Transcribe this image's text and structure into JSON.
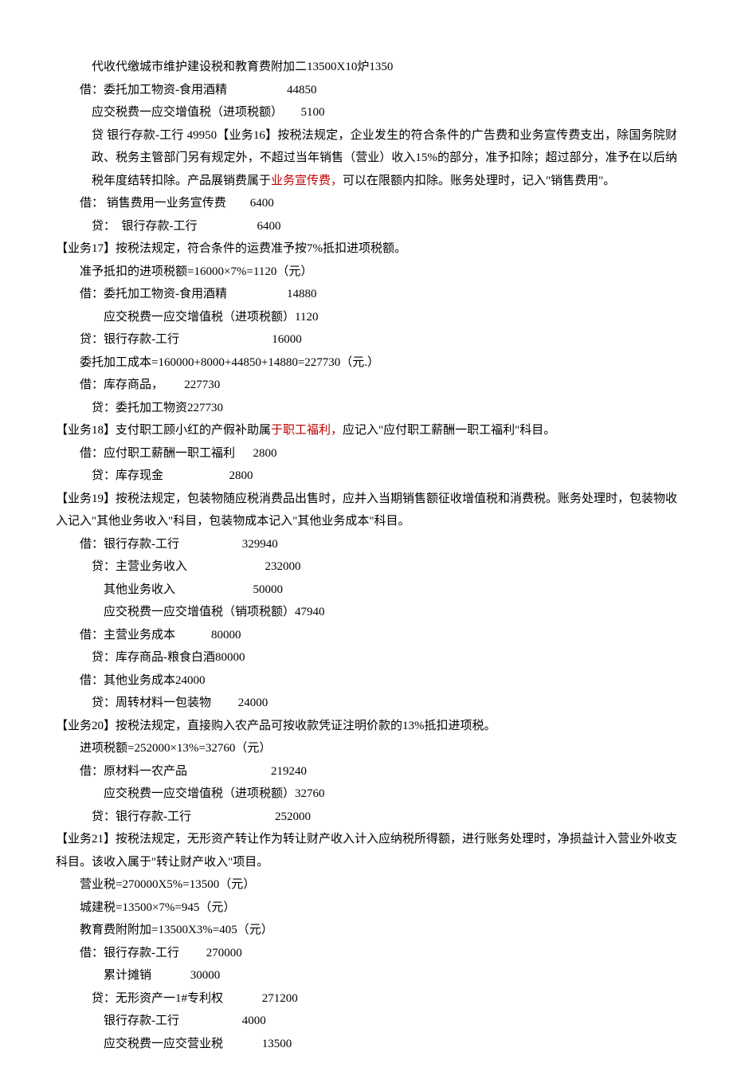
{
  "lines": [
    {
      "cls": "indent2",
      "parts": [
        {
          "t": "代收代缴城市维护建设税和教育费附加二13500X10炉1350"
        }
      ]
    },
    {
      "cls": "indent1",
      "parts": [
        {
          "t": "借：委托加工物资-食用酒精                    44850"
        }
      ]
    },
    {
      "cls": "indent2",
      "parts": [
        {
          "t": "应交税费一应交增值税（进项税额）      5100"
        }
      ]
    },
    {
      "cls": "indent2 para",
      "parts": [
        {
          "t": "贷 银行存款-工行                      49950【业务16】按税法规定，企业发生的符合条件的广告费和业务宣传费支出，除国务院财政、税务主管部门另有规定外，不超过当年销售（营业）收入15%的部分，准予扣除；超过部分，准予在以后纳税年度结转扣除。产品展销费属于"
        },
        {
          "t": "业务宣传费，",
          "red": true
        },
        {
          "t": "可以在限额内扣除。账务处理时，记入\"销售费用\"。"
        }
      ],
      "wrap": true
    },
    {
      "cls": "indent1",
      "parts": [
        {
          "t": "借： 销售费用一业务宣传费        6400"
        }
      ]
    },
    {
      "cls": "indent2",
      "parts": [
        {
          "t": "贷：  银行存款-工行                    6400"
        }
      ]
    },
    {
      "cls": "",
      "parts": [
        {
          "t": "【业务17】按税法规定，符合条件的运费准予按7%抵扣进项税额。"
        }
      ]
    },
    {
      "cls": "indent1",
      "parts": [
        {
          "t": "准予抵扣的进项税额=16000×7%=1120（元）"
        }
      ]
    },
    {
      "cls": "indent1",
      "parts": [
        {
          "t": "借：委托加工物资-食用酒精                    14880"
        }
      ]
    },
    {
      "cls": "indent3",
      "parts": [
        {
          "t": "应交税费一应交增值税（进项税额）1120"
        }
      ]
    },
    {
      "cls": "indent1",
      "parts": [
        {
          "t": "贷：银行存款-工行                               16000"
        }
      ]
    },
    {
      "cls": "indent1",
      "parts": [
        {
          "t": "委托加工成本=160000+8000+44850+14880=227730（元.）"
        }
      ]
    },
    {
      "cls": "indent1",
      "parts": [
        {
          "t": "借：库存商品，       227730"
        }
      ]
    },
    {
      "cls": "indent2",
      "parts": [
        {
          "t": "贷：委托加工物资227730"
        }
      ]
    },
    {
      "cls": "",
      "parts": [
        {
          "t": "【业务18】支付职工顾小红的产假补助属"
        },
        {
          "t": "于职工福利，",
          "red": true
        },
        {
          "t": "应记入\"应付职工薪酬一职工福利\"科目。"
        }
      ]
    },
    {
      "cls": "indent1",
      "parts": [
        {
          "t": "借：应付职工薪酬一职工福利      2800"
        }
      ]
    },
    {
      "cls": "indent2",
      "parts": [
        {
          "t": "贷：库存现金                      2800"
        }
      ]
    },
    {
      "cls": "para",
      "parts": [
        {
          "t": "【业务19】按税法规定，包装物随应税消费品出售时，应并入当期销售额征收增值税和消费税。账务处理时，包装物收入记入\"其他业务收入\"科目，包装物成本记入\"其他业务成本\"科目。"
        }
      ],
      "wrap": true
    },
    {
      "cls": "indent1",
      "parts": [
        {
          "t": "借：银行存款-工行                     329940"
        }
      ]
    },
    {
      "cls": "indent2",
      "parts": [
        {
          "t": "贷：主营业务收入                          232000"
        }
      ]
    },
    {
      "cls": "indent3",
      "parts": [
        {
          "t": "其他业务收入                          50000"
        }
      ]
    },
    {
      "cls": "indent3",
      "parts": [
        {
          "t": "应交税费一应交增值税（销项税额）47940"
        }
      ]
    },
    {
      "cls": "indent1",
      "parts": [
        {
          "t": "借：主营业务成本            80000"
        }
      ]
    },
    {
      "cls": "indent2",
      "parts": [
        {
          "t": "贷：库存商品-粮食白酒80000"
        }
      ]
    },
    {
      "cls": "indent1",
      "parts": [
        {
          "t": "借：其他业务成本24000"
        }
      ]
    },
    {
      "cls": "indent2",
      "parts": [
        {
          "t": "贷：周转材料一包装物         24000"
        }
      ]
    },
    {
      "cls": "",
      "parts": [
        {
          "t": "【业务20】按税法规定，直接购入农产品可按收款凭证注明价款的13%抵扣进项税。"
        }
      ]
    },
    {
      "cls": "indent1",
      "parts": [
        {
          "t": "进项税额=252000×13%=32760（元）"
        }
      ]
    },
    {
      "cls": "indent1",
      "parts": [
        {
          "t": "借：原材料一农产品                            219240"
        }
      ]
    },
    {
      "cls": "indent3",
      "parts": [
        {
          "t": "应交税费一应交增值税（进项税额）32760"
        }
      ]
    },
    {
      "cls": "indent2",
      "parts": [
        {
          "t": "贷：银行存款-工行                            252000"
        }
      ]
    },
    {
      "cls": "para",
      "parts": [
        {
          "t": "【业务21】按税法规定，无形资产转让作为转让财产收入计入应纳税所得额，进行账务处理时，净损益计入营业外收支科目。该收入属于\"转让财产收入\"项目。"
        }
      ],
      "wrap": true
    },
    {
      "cls": "indent1",
      "parts": [
        {
          "t": "营业税=270000X5%=13500（元）"
        }
      ]
    },
    {
      "cls": "indent1",
      "parts": [
        {
          "t": "城建税=13500×7%=945（元）"
        }
      ]
    },
    {
      "cls": "indent1",
      "parts": [
        {
          "t": "教育费附附加=13500X3%=405（元）"
        }
      ]
    },
    {
      "cls": "indent1",
      "parts": [
        {
          "t": "借：银行存款-工行         270000"
        }
      ]
    },
    {
      "cls": "indent3",
      "parts": [
        {
          "t": "累计摊销             30000"
        }
      ]
    },
    {
      "cls": "indent2",
      "parts": [
        {
          "t": "贷：无形资产一1#专利权             271200"
        }
      ]
    },
    {
      "cls": "indent3",
      "parts": [
        {
          "t": "银行存款-工行                     4000"
        }
      ]
    },
    {
      "cls": "indent3",
      "parts": [
        {
          "t": "应交税费一应交营业税             13500"
        }
      ]
    }
  ]
}
